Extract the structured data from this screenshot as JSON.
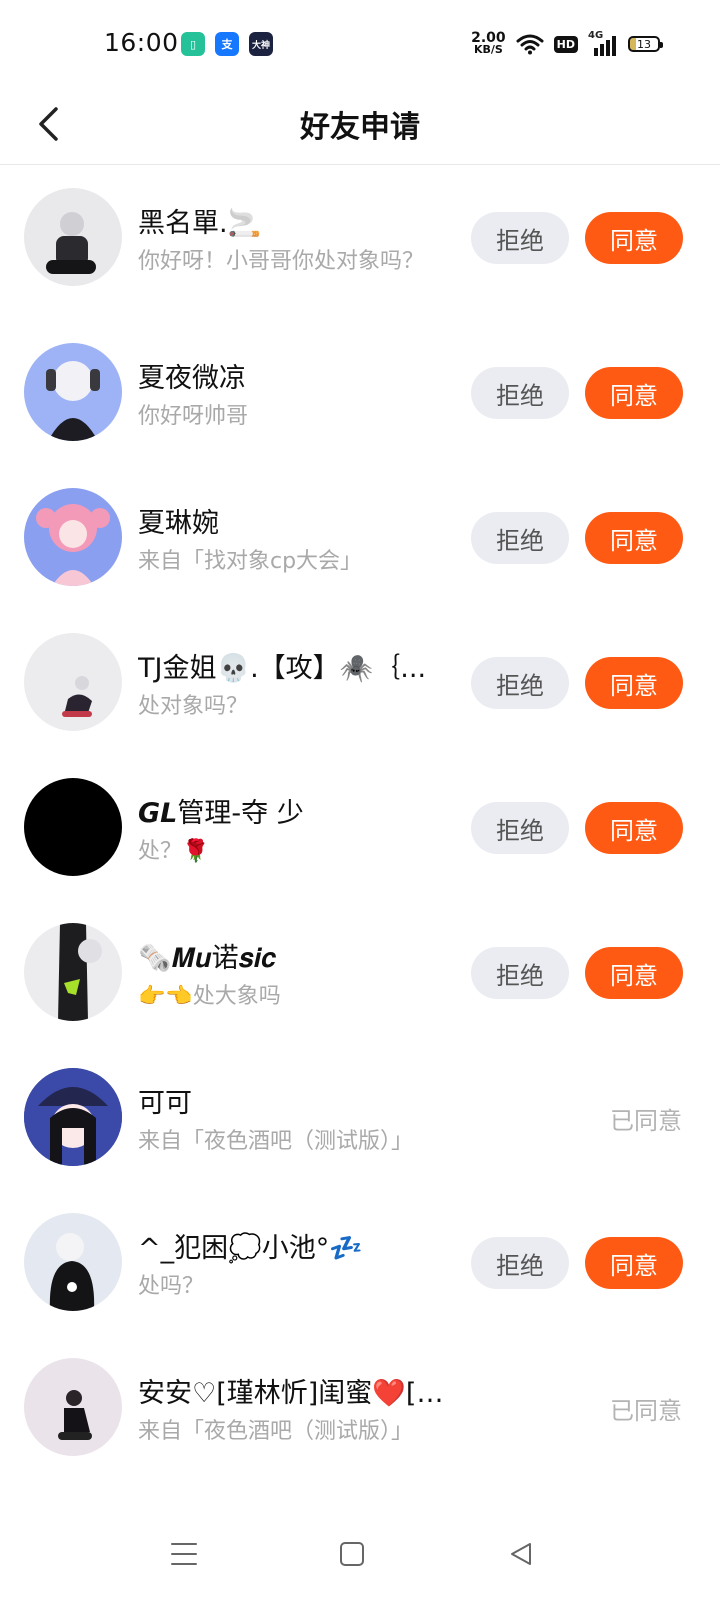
{
  "status_bar": {
    "time": "16:00",
    "apps": [
      {
        "icon": "green-app-icon",
        "label": "",
        "color": "#25c29a"
      },
      {
        "icon": "alipay-icon",
        "label": "支",
        "color": "#1677ff"
      },
      {
        "icon": "dashen-app-icon",
        "label": "大神",
        "color": "#1c2340"
      }
    ],
    "net_speed": "2.00",
    "net_unit": "KB/S",
    "hd": "HD",
    "signal": "4G",
    "battery": "13"
  },
  "header": {
    "title": "好友申请"
  },
  "requests": [
    {
      "name": "黑名單.🚬",
      "message": "你好呀！小哥哥你处对象吗？",
      "status": "pending",
      "avatar_bg": "#e9e9ec"
    },
    {
      "name": "夏夜微凉",
      "message": "你好呀帅哥",
      "status": "pending",
      "avatar_bg": "#9eb3f5"
    },
    {
      "name": "夏琳婉",
      "message": "来自「找对象cp大会」",
      "status": "pending",
      "avatar_bg": "#8a9ff0"
    },
    {
      "name": "TJ金姐💀.【攻】🕷️｛...",
      "message": "处对象吗？",
      "status": "pending",
      "avatar_bg": "#ececef"
    },
    {
      "name": "𝙂𝙇管理-夺 少",
      "message": "处？🌹",
      "status": "pending",
      "avatar_bg": "#000000"
    },
    {
      "name": "🗞️𝑴𝒖诺𝒔𝒊𝒄",
      "message": "👉👈处大象吗",
      "status": "pending",
      "avatar_bg": "#ececef"
    },
    {
      "name": "可可",
      "message": "来自「夜色酒吧（测试版）」",
      "status": "accepted",
      "avatar_bg": "#3b4aa8"
    },
    {
      "name": "^_犯困💭小池°💤",
      "message": "处吗？",
      "status": "pending",
      "avatar_bg": "#e4e8f0"
    },
    {
      "name": "安安♡[瑾林忻]闺蜜❤️[找对象]",
      "message": "来自「夜色酒吧（测试版）」",
      "status": "accepted",
      "avatar_bg": "#ebe3ea"
    }
  ],
  "labels": {
    "reject": "拒绝",
    "accept": "同意",
    "accepted": "已同意"
  },
  "colors": {
    "accent": "#ff5a14",
    "reject_bg": "#eaecf1",
    "muted_text": "#a9a9a9"
  }
}
